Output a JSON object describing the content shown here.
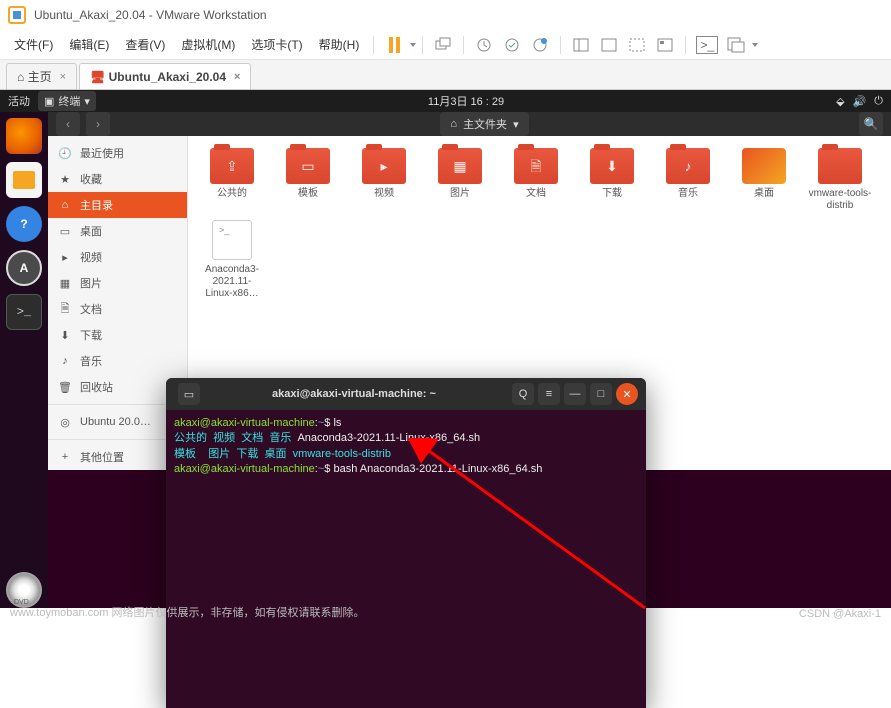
{
  "vmware": {
    "title": "Ubuntu_Akaxi_20.04 - VMware Workstation",
    "menu": [
      "文件(F)",
      "编辑(E)",
      "查看(V)",
      "虚拟机(M)",
      "选项卡(T)",
      "帮助(H)"
    ],
    "tabs": {
      "home": "主页",
      "vm": "Ubuntu_Akaxi_20.04"
    }
  },
  "ubuntu": {
    "topbar": {
      "activities": "活动",
      "terminal": "终端",
      "clock": "11月3日 16 : 29"
    },
    "files": {
      "path": "主文件夹",
      "sidebar": [
        {
          "icon": "🕘",
          "label": "最近使用"
        },
        {
          "icon": "★",
          "label": "收藏"
        },
        {
          "icon": "⌂",
          "label": "主目录",
          "active": true
        },
        {
          "icon": "▭",
          "label": "桌面"
        },
        {
          "icon": "▸",
          "label": "视频"
        },
        {
          "icon": "▦",
          "label": "图片"
        },
        {
          "icon": "🗎",
          "label": "文档"
        },
        {
          "icon": "⬇",
          "label": "下载"
        },
        {
          "icon": "♪",
          "label": "音乐"
        },
        {
          "icon": "🗑",
          "label": "回收站"
        },
        {
          "icon": "◎",
          "label": "Ubuntu 20.0…"
        },
        {
          "icon": "+",
          "label": "其他位置"
        }
      ],
      "items": [
        {
          "type": "folder",
          "glyph": "⇪",
          "label": "公共的"
        },
        {
          "type": "folder",
          "glyph": "▭",
          "label": "模板"
        },
        {
          "type": "folder",
          "glyph": "▸",
          "label": "视频"
        },
        {
          "type": "folder",
          "glyph": "▦",
          "label": "图片"
        },
        {
          "type": "folder",
          "glyph": "🗎",
          "label": "文档"
        },
        {
          "type": "folder",
          "glyph": "⬇",
          "label": "下载"
        },
        {
          "type": "folder",
          "glyph": "♪",
          "label": "音乐"
        },
        {
          "type": "img",
          "label": "桌面"
        },
        {
          "type": "folder",
          "glyph": "",
          "label": "vmware-tools-distrib"
        },
        {
          "type": "txt",
          "label": "Anaconda3-2021.11-Linux-x86…"
        }
      ]
    },
    "terminal": {
      "title": "akaxi@akaxi-virtual-machine: ~",
      "prompt_user": "akaxi@akaxi-virtual-machine",
      "prompt_path": "~",
      "cmd1": "ls",
      "ls_row1_dirs": "公共的  视频  文档  音乐",
      "ls_row1_file": "Anaconda3-2021.11-Linux-x86_64.sh",
      "ls_row2_dirs": "模板    图片  下载  桌面",
      "ls_row2_file": "vmware-tools-distrib",
      "cmd2": "bash Anaconda3-2021.11-Linux-x86_64.sh"
    }
  },
  "watermark": {
    "left": "www.toymoban.com 网络图片仅供展示，非存储，如有侵权请联系删除。",
    "right": "CSDN @Akaxi-1"
  }
}
